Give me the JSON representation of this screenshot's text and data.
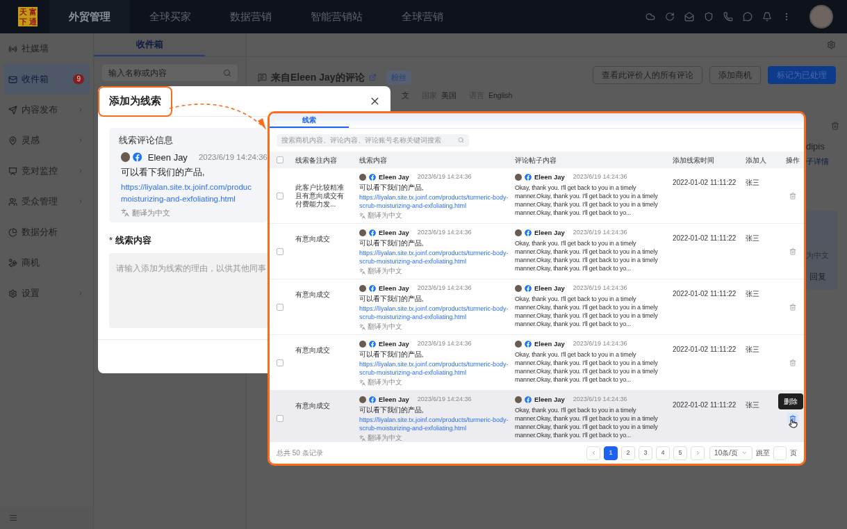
{
  "top_nav": {
    "logo": "天富下通",
    "items": [
      {
        "label": "外贸管理",
        "selected": true
      },
      {
        "label": "全球买家",
        "selected": false
      },
      {
        "label": "数据营销",
        "selected": false
      },
      {
        "label": "智能营销站",
        "selected": false
      },
      {
        "label": "全球营销",
        "selected": false
      }
    ]
  },
  "sidebar": {
    "items": [
      {
        "label": "社媒墙",
        "selected": false,
        "expandable": false
      },
      {
        "label": "收件箱",
        "selected": true,
        "expandable": false,
        "badge": "9"
      },
      {
        "label": "内容发布",
        "selected": false,
        "expandable": true
      },
      {
        "label": "灵感",
        "selected": false,
        "expandable": true
      },
      {
        "label": "竞对监控",
        "selected": false,
        "expandable": true
      },
      {
        "label": "受众管理",
        "selected": false,
        "expandable": true
      },
      {
        "label": "数据分析",
        "selected": false,
        "expandable": false
      },
      {
        "label": "商机",
        "selected": false,
        "expandable": false
      },
      {
        "label": "设置",
        "selected": false,
        "expandable": true
      }
    ]
  },
  "inbox_panel": {
    "tab": "收件箱",
    "search_placeholder": "输入名称或内容"
  },
  "detail": {
    "title": "来自Eleen Jay的评论",
    "tag": "粉丝",
    "meta_fragment": "文",
    "meta": [
      {
        "label": "国家",
        "value": "美国"
      },
      {
        "label": "语言",
        "value": "English"
      }
    ],
    "buttons": [
      {
        "label": "查看此评价人的所有评论",
        "kind": "default"
      },
      {
        "label": "添加商机",
        "kind": "default"
      },
      {
        "label": "标记为已处理",
        "kind": "primary"
      }
    ],
    "side_name": "dipis",
    "side_link": "子详情",
    "side_translate": "为中文",
    "side_reply": "回复"
  },
  "modal": {
    "title": "添加为线索",
    "card_title": "线索评论信息",
    "author": "Eleen Jay",
    "time": "2023/6/19  14:24:36",
    "text": "可以看下我们的产品,",
    "link_lines": [
      "https://liyalan.site.tx.joinf.com/produc",
      "moisturizing-and-exfoliating.html"
    ],
    "translate": "翻译为中文",
    "field_label": "线索内容",
    "required_mark": "*",
    "placeholder": "请输入添加为线索的理由，以供其他同事"
  },
  "leads_panel": {
    "tab": "线索",
    "search_placeholder": "搜索商机内容、评论内容、评论账号名称关键词搜索",
    "all_checked": false,
    "columns": [
      "线索备注内容",
      "线索内容",
      "评论帖子内容",
      "添加线索时间",
      "添加人",
      "操作"
    ],
    "rows": [
      {
        "checked": false,
        "hovered": false,
        "note": "此客户比较精准且有意向成交有付费能力发...",
        "author": "Eleen Jay",
        "time": "2023/6/19  14:24:36",
        "text": "可以看下我们的产品,",
        "link": "https://liyalan.site.tx.joinf.com/products/turmeric-body- scrub-moisturizing-and-exfoliating.html",
        "translate": "翻译为中文",
        "post_author": "Eleen Jay",
        "post_time": "2023/6/19 14:24:36",
        "post_text": "Okay, thank you. I'll get back to you in a timely manner.Okay, thank you. I'll get back to you in a timely manner.Okay, thank you. I'll get back to you in a timely manner.Okay, thank you. I'll get back to yo...",
        "added_time": "2022-01-02 11:11:22",
        "added_by": "张三"
      },
      {
        "checked": false,
        "hovered": false,
        "note": "有意向成交",
        "author": "Eleen Jay",
        "time": "2023/6/19  14:24:36",
        "text": "可以看下我们的产品,",
        "link": "https://liyalan.site.tx.joinf.com/products/turmeric-body- scrub-moisturizing-and-exfoliating.html",
        "translate": "翻译为中文",
        "post_author": "Eleen Jay",
        "post_time": "2023/6/19 14:24:36",
        "post_text": "Okay, thank you. I'll get back to you in a timely manner.Okay, thank you. I'll get back to you in a timely manner.Okay, thank you. I'll get back to you in a timely manner.Okay, thank you. I'll get back to yo...",
        "added_time": "2022-01-02 11:11:22",
        "added_by": "张三"
      },
      {
        "checked": false,
        "hovered": false,
        "note": "有意向成交",
        "author": "Eleen Jay",
        "time": "2023/6/19  14:24:36",
        "text": "可以看下我们的产品,",
        "link": "https://liyalan.site.tx.joinf.com/products/turmeric-body- scrub-moisturizing-and-exfoliating.html",
        "translate": "翻译为中文",
        "post_author": "Eleen Jay",
        "post_time": "2023/6/19 14:24:36",
        "post_text": "Okay, thank you. I'll get back to you in a timely manner.Okay, thank you. I'll get back to you in a timely manner.Okay, thank you. I'll get back to you in a timely manner.Okay, thank you. I'll get back to yo...",
        "added_time": "2022-01-02 11:11:22",
        "added_by": "张三"
      },
      {
        "checked": false,
        "hovered": false,
        "note": "有意向成交",
        "author": "Eleen Jay",
        "time": "2023/6/19  14:24:36",
        "text": "可以看下我们的产品,",
        "link": "https://liyalan.site.tx.joinf.com/products/turmeric-body- scrub-moisturizing-and-exfoliating.html",
        "translate": "翻译为中文",
        "post_author": "Eleen Jay",
        "post_time": "2023/6/19 14:24:36",
        "post_text": "Okay, thank you. I'll get back to you in a timely manner.Okay, thank you. I'll get back to you in a timely manner.Okay, thank you. I'll get back to you in a timely manner.Okay, thank you. I'll get back to yo...",
        "added_time": "2022-01-02 11:11:22",
        "added_by": "张三"
      },
      {
        "checked": false,
        "hovered": true,
        "note": "有意向成交",
        "author": "Eleen Jay",
        "time": "2023/6/19  14:24:36",
        "text": "可以看下我们的产品,",
        "link": "https://liyalan.site.tx.joinf.com/products/turmeric-body- scrub-moisturizing-and-exfoliating.html",
        "translate": "翻译为中文",
        "post_author": "Eleen Jay",
        "post_time": "2023/6/19 14:24:36",
        "post_text": "Okay, thank you. I'll get back to you in a timely manner.Okay, thank you. I'll get back to you in a timely manner.Okay, thank you. I'll get back to you in a timely manner.Okay, thank you. I'll get back to yo...",
        "added_time": "2022-01-02 11:11:22",
        "added_by": "张三"
      }
    ],
    "tooltip": "删除",
    "footer": {
      "total": "总共 50 条记录",
      "pages": [
        {
          "label": "1",
          "selected": true
        },
        {
          "label": "2",
          "selected": false
        },
        {
          "label": "3",
          "selected": false
        },
        {
          "label": "4",
          "selected": false
        },
        {
          "label": "5",
          "selected": false
        }
      ],
      "page_size": "10条/页",
      "jump_label": "跳至",
      "page_unit": "页"
    }
  }
}
